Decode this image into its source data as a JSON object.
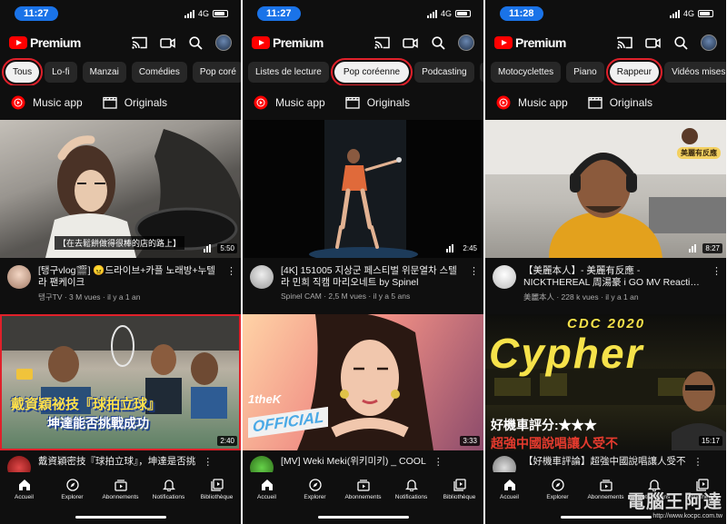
{
  "status": {
    "network": "4G"
  },
  "app": {
    "logo_text": "Premium"
  },
  "links": {
    "music_app": "Music app",
    "originals": "Originals"
  },
  "nav": [
    "Accueil",
    "Explorer",
    "Abonnements",
    "Notifications",
    "Bibliothèque"
  ],
  "screens": [
    {
      "time": "11:27",
      "chips": [
        "Tous",
        "Lo-fi",
        "Manzai",
        "Comédies",
        "Pop coré"
      ],
      "selected_chip_index": 0,
      "video1": {
        "caption": "【在去鬆餅做得很棒的店的路上】",
        "duration": "5:50",
        "title": "[탱구vlog🎬] 😠드라이브+카플 노래방+누텔라 팬케이크",
        "channel_meta": "탱구TV · 3 M vues · il y a 1 an"
      },
      "video2": {
        "badge": "",
        "overlay_line1": "戴資穎祕技『球拍立球』",
        "overlay_line2": "坤達能否挑戰成功",
        "duration": "2:40",
        "title": "戴資穎密技『球拍立球』，坤達是否挑"
      }
    },
    {
      "time": "11:27",
      "chips": [
        "Listes de lecture",
        "Pop coréenne",
        "Podcasting",
        "C"
      ],
      "selected_chip_index": 1,
      "video1": {
        "duration": "2:45",
        "title": "[4K] 151005 지상군 페스티벌 위문열차 스텔라 민희 직캠 마리오네트 by Spinel",
        "channel_meta": "Spinel CAM · 2,5 M vues · il y a 5 ans"
      },
      "video2": {
        "brand": "1theK",
        "overlay_line1": "OFFICIAL",
        "duration": "3:33",
        "title": "[MV] Weki Meki(위키미키) _ COOL"
      }
    },
    {
      "time": "11:28",
      "chips": [
        "Motocyclettes",
        "Piano",
        "Rappeur",
        "Vidéos mises en"
      ],
      "selected_chip_index": 2,
      "video1": {
        "corner_badge": "美麗有反應",
        "duration": "8:27",
        "title": "【美麗本人】- 美麗有反應 - NICKTHEREAL 周湯豪 i GO MV Reacti…",
        "channel_meta": "美麗本人 · 228 k vues · il y a 1 an"
      },
      "video2": {
        "overlay_top": "CDC 2020",
        "overlay_big": "Cypher",
        "overlay_line1": "好機車評分:★★★",
        "overlay_line2": "超強中國說唱讓人受不",
        "duration": "15:17",
        "title": "【好機車評論】超強中國說唱讓人受不"
      }
    }
  ],
  "watermark": {
    "title": "電腦王阿達",
    "url": "http://www.kocpc.com.tw"
  },
  "colors": {
    "highlight": "#e0202a",
    "youtube_red": "#ff0000",
    "background": "#0f0f0f",
    "chip": "#272727"
  }
}
